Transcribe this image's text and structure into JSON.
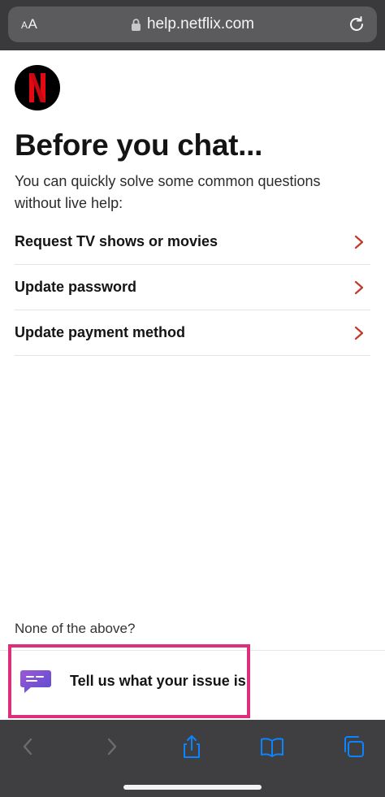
{
  "browser": {
    "reader_label": "AA",
    "url": "help.netflix.com"
  },
  "page": {
    "logo_letter": "N",
    "title": "Before you chat...",
    "subtitle": "You can quickly solve some common questions without live help:",
    "items": [
      {
        "label": "Request TV shows or movies"
      },
      {
        "label": "Update password"
      },
      {
        "label": "Update payment method"
      }
    ],
    "none_above": "None of the above?",
    "issue_button": "Tell us what your issue is"
  },
  "colors": {
    "netflix_red": "#e50914",
    "chevron": "#c0392b",
    "highlight": "#dd2d7b",
    "ios_blue": "#0a84ff"
  },
  "icons": [
    "lock-icon",
    "reload-icon",
    "chevron-right-icon",
    "chat-bubble-icon",
    "back-icon",
    "forward-icon",
    "share-icon",
    "bookmarks-icon",
    "tabs-icon"
  ]
}
